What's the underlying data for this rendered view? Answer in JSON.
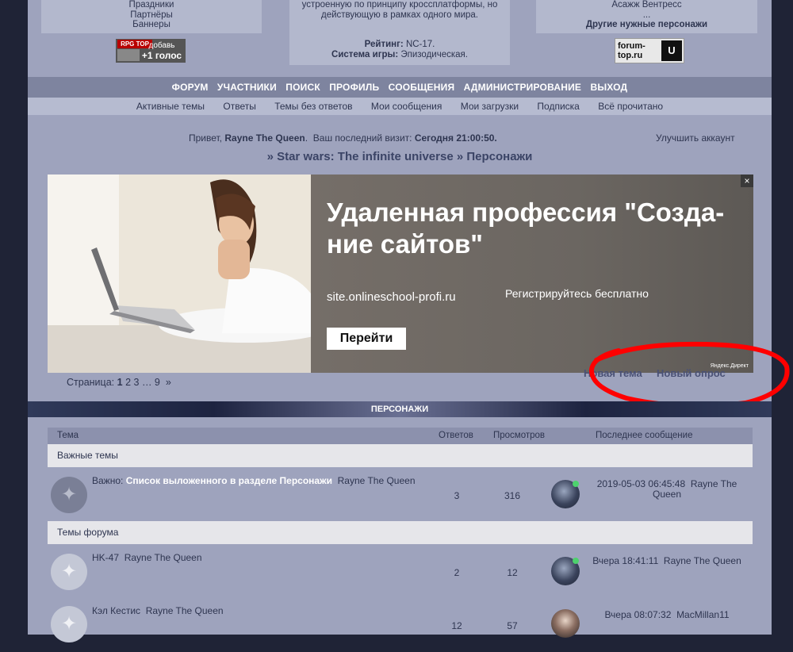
{
  "header": {
    "left_links": [
      "Праздники",
      "Партнёры",
      "Баннеры"
    ],
    "middle_desc": [
      "устроенную по принципу кроссплатформы, но",
      "действующую в рамках одного мира."
    ],
    "rating_label": "Рейтинг:",
    "rating_value": "NC-17.",
    "system_label": "Система игры:",
    "system_value": "Эпизодическая.",
    "right_name": "Асажж Вентресс",
    "right_ellipsis": "...",
    "right_link": "Другие нужные персонажи",
    "counter_left": {
      "title": "RPG TOP",
      "vote_top": "добавь",
      "vote_bottom": "+1 голос"
    },
    "counter_right": {
      "text_top": "forum-",
      "text_bottom": "top.ru",
      "logo": "U"
    }
  },
  "main_nav": [
    "ФОРУМ",
    "УЧАСТНИКИ",
    "ПОИСК",
    "ПРОФИЛЬ",
    "СООБЩЕНИЯ",
    "АДМИНИСТРИРОВАНИЕ",
    "ВЫХОД"
  ],
  "sub_nav": [
    "Активные темы",
    "Ответы",
    "Темы без ответов",
    "Мои сообщения",
    "Мои загрузки",
    "Подписка",
    "Всё прочитано"
  ],
  "welcome": {
    "greeting": "Привет,",
    "user": "Rayne The Queen",
    "last_visit_label": "Ваш последний визит:",
    "last_visit_value": "Сегодня 21:00:50.",
    "upgrade": "Улучшить аккаунт"
  },
  "breadcrumb": {
    "sep1": "»",
    "forum": "Star wars: The infinite universe",
    "sep2": "»",
    "section": "Персонажи"
  },
  "ad": {
    "headline_line1": "Удаленная профессия \"Созда-",
    "headline_line2": "ние сайтов\"",
    "domain": "site.onlineschool-profi.ru",
    "register": "Регистрируйтесь бесплатно",
    "button": "Перейти",
    "close": "×",
    "network": "Яндекс.Директ"
  },
  "pager": {
    "label": "Страница:",
    "current": "1",
    "pages": [
      "2",
      "3"
    ],
    "ellipsis": "…",
    "last": "9",
    "next": "»"
  },
  "actions": {
    "new_topic": "Новая тема",
    "new_poll": "Новый опрос"
  },
  "forum_banner": "ПЕРСОНАЖИ",
  "table": {
    "headers": {
      "topic": "Тема",
      "replies": "Ответов",
      "views": "Просмотров",
      "last_post": "Последнее сообщение"
    },
    "section_important": "Важные темы",
    "section_topics": "Темы форума",
    "important_row": {
      "prefix": "Важно:",
      "title": "Список выложенного в разделе Персонажи",
      "author": "Rayne The Queen",
      "replies": "3",
      "views": "316",
      "last_time": "2019-05-03 06:45:48",
      "last_user": "Rayne The Queen"
    },
    "rows": [
      {
        "title": "HK-47",
        "author": "Rayne The Queen",
        "replies": "2",
        "views": "12",
        "last_time": "Вчера 18:41:11",
        "last_user": "Rayne The Queen"
      },
      {
        "title": "Кэл Кестис",
        "author": "Rayne The Queen",
        "replies": "12",
        "views": "57",
        "last_time": "Вчера 08:07:32",
        "last_user": "MacMillan11"
      }
    ]
  },
  "colors": {
    "page_bg": "#9ea3bd",
    "outer_bg": "#1f2336",
    "nav_bg": "#7e849f",
    "annotation": "#ff0000"
  },
  "icons": {
    "forum_icon": "rebel-alliance-icon",
    "close": "close-icon",
    "online": "online-dot-icon"
  }
}
